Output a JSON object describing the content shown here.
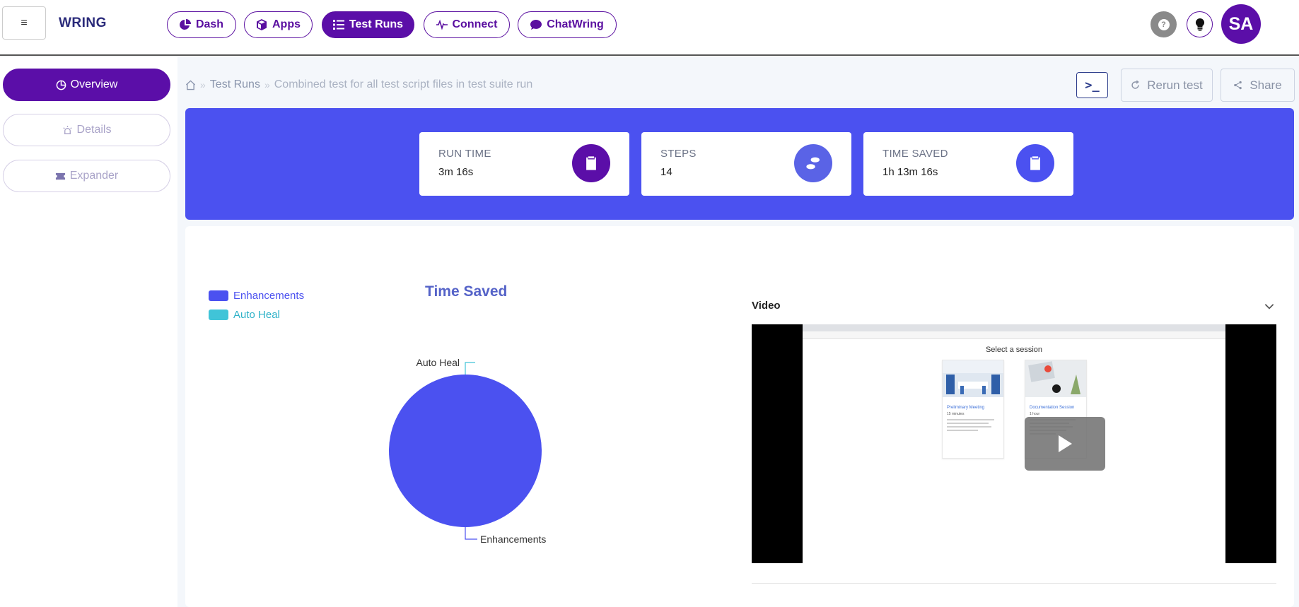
{
  "app": {
    "brand": "WRING",
    "menu_icon": "hamburger-icon",
    "avatar_initials": "SA",
    "help_icon": "question-icon",
    "ideas_icon": "lightbulb-icon"
  },
  "nav": {
    "items": [
      {
        "label": "Dash",
        "icon": "pie-chart-icon",
        "active": false
      },
      {
        "label": "Apps",
        "icon": "cube-icon",
        "active": false
      },
      {
        "label": "Test Runs",
        "icon": "list-icon",
        "active": true
      },
      {
        "label": "Connect",
        "icon": "pulse-icon",
        "active": false
      },
      {
        "label": "ChatWring",
        "icon": "chat-bubble-icon",
        "active": false
      }
    ]
  },
  "sidebar": {
    "items": [
      {
        "label": "Overview",
        "icon": "pie-chart-icon",
        "active": true
      },
      {
        "label": "Details",
        "icon": "alarm-icon",
        "active": false
      },
      {
        "label": "Expander",
        "icon": "ticket-icon",
        "active": false
      }
    ]
  },
  "breadcrumb": {
    "home_icon": "home-icon",
    "items": [
      "Test Runs",
      "Combined test for all test script files in test suite run"
    ]
  },
  "actions": {
    "terminal_label": ">_",
    "rerun_label": "Rerun test",
    "share_label": "Share"
  },
  "stats": [
    {
      "label": "RUN TIME",
      "value": "3m 16s",
      "icon": "clipboard-icon",
      "color": "#5b0ea8"
    },
    {
      "label": "STEPS",
      "value": "14",
      "icon": "footprints-icon",
      "color": "#5a63e6"
    },
    {
      "label": "TIME SAVED",
      "value": "1h 13m 16s",
      "icon": "clipboard-icon",
      "color": "#4b51f0"
    }
  ],
  "chart_data": {
    "type": "pie",
    "title": "Time Saved",
    "labels": [
      "Enhancements",
      "Auto Heal"
    ],
    "values": [
      100,
      0
    ],
    "colors": [
      "#4b51f0",
      "#40c4d8"
    ],
    "legend_position": "top-left"
  },
  "video": {
    "title": "Video",
    "screen_heading": "Select a session",
    "sessions": [
      {
        "name": "Preliminary Meeting",
        "duration": "15 minutes"
      },
      {
        "name": "Documentation Session",
        "duration": "1 hour"
      }
    ]
  },
  "colors": {
    "brand_purple": "#5b0ea8",
    "banner_blue": "#4b51f0",
    "teal": "#40c4d8"
  }
}
